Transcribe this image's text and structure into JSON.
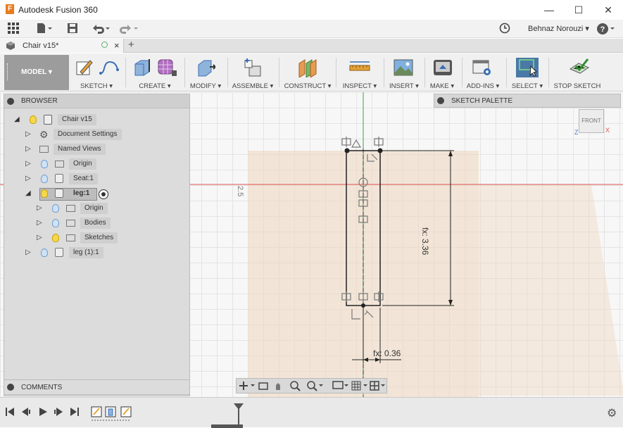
{
  "app": {
    "title": "Autodesk Fusion 360",
    "logo": "F"
  },
  "window_controls": {
    "minimize": "—",
    "maximize": "☐",
    "close": "✕"
  },
  "quick_access": {
    "apps_icon": "grid-icon",
    "file_icon": "file-icon",
    "save_icon": "save-icon",
    "undo_icon": "undo-icon",
    "redo_icon": "redo-icon"
  },
  "user": {
    "name": "Behnaz Norouzi ▾",
    "help": "?"
  },
  "document_tab": {
    "title": "Chair v15*",
    "close": "×",
    "new_tab": "+"
  },
  "ribbon": {
    "workspace": "MODEL ▾",
    "groups": [
      {
        "label": "SKETCH ▾"
      },
      {
        "label": "CREATE ▾"
      },
      {
        "label": "MODIFY ▾"
      },
      {
        "label": "ASSEMBLE ▾"
      },
      {
        "label": "CONSTRUCT ▾"
      },
      {
        "label": "INSPECT ▾"
      },
      {
        "label": "INSERT ▾"
      },
      {
        "label": "MAKE ▾"
      },
      {
        "label": "ADD-INS ▾"
      },
      {
        "label": "SELECT ▾"
      },
      {
        "label": "STOP SKETCH"
      }
    ]
  },
  "browser": {
    "title": "BROWSER",
    "root": "Chair v15",
    "items": [
      {
        "label": "Document Settings"
      },
      {
        "label": "Named Views"
      },
      {
        "label": "Origin"
      },
      {
        "label": "Seat:1"
      },
      {
        "label": "leg:1"
      },
      {
        "label": "Origin"
      },
      {
        "label": "Bodies"
      },
      {
        "label": "Sketches"
      },
      {
        "label": "leg (1):1"
      }
    ]
  },
  "comments": {
    "title": "COMMENTS"
  },
  "sketch_palette": {
    "title": "SKETCH PALETTE"
  },
  "viewcube": {
    "face": "FRONT",
    "x": "X",
    "z": "Z"
  },
  "dimensions": {
    "height": "fx: 3.36",
    "width": "fx: 0.36",
    "grid_label": "2.5"
  },
  "colors": {
    "accent": "#4a79a8",
    "sketch_plane": "#eed7be",
    "red_axis": "#e05050",
    "green_axis": "#3aa33a"
  }
}
